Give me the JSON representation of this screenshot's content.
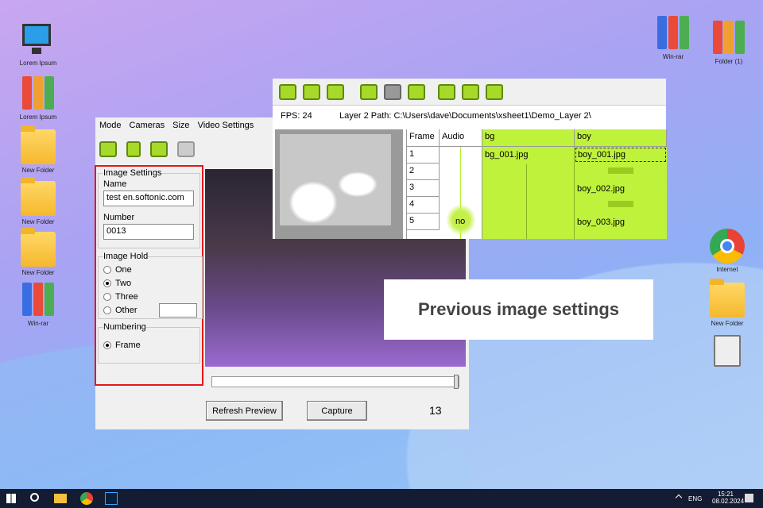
{
  "desktop": {
    "left_icons": [
      "Lorem Ipsum",
      "Lorem Ipsum",
      "New Folder",
      "New Folder",
      "New Folder",
      "Win-rar"
    ],
    "right_top_icons": [
      "Win-rar",
      "Folder (1)"
    ],
    "right_icons": [
      "Internet",
      "New Folder"
    ]
  },
  "capture_window": {
    "menu": [
      "Mode",
      "Cameras",
      "Size",
      "Video Settings"
    ],
    "image_settings": {
      "title": "Image Settings",
      "name_label": "Name",
      "name_value": "test en.softonic.com",
      "number_label": "Number",
      "number_value": "0013"
    },
    "image_hold": {
      "title": "Image Hold",
      "options": [
        "One",
        "Two",
        "Three",
        "Other"
      ],
      "selected": "Two"
    },
    "numbering": {
      "title": "Numbering",
      "option": "Frame"
    },
    "refresh_label": "Refresh Preview",
    "capture_label": "Capture",
    "frame_count": "13"
  },
  "xsheet": {
    "fps": "FPS: 24",
    "path": "Layer 2 Path: C:\\Users\\dave\\Documents\\xsheet1\\Demo_Layer 2\\",
    "headers": [
      "Frame",
      "Audio",
      "bg",
      "boy"
    ],
    "frames": [
      "1",
      "2",
      "3",
      "4",
      "5"
    ],
    "audio_text": "no",
    "bg_cells": [
      "bg_001.jpg"
    ],
    "boy_cells": [
      "boy_001.jpg",
      "boy_002.jpg",
      "boy_003.jpg"
    ]
  },
  "caption": "Previous image settings",
  "taskbar": {
    "lang": "ENG",
    "time": "15:21",
    "date": "08.02.2024"
  }
}
